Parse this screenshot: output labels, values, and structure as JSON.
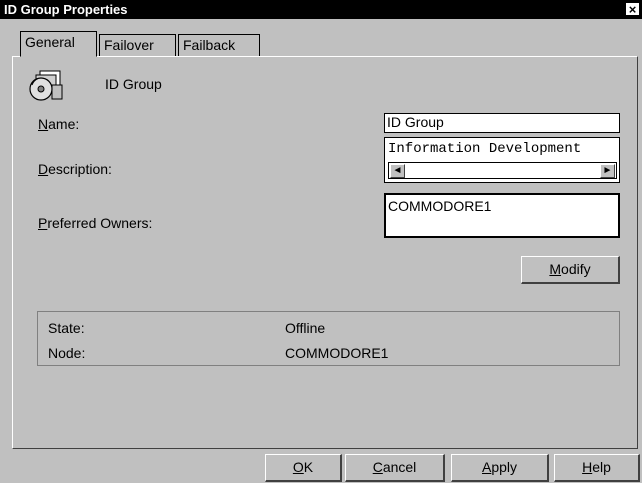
{
  "window": {
    "title": "ID Group Properties",
    "close_glyph": "×"
  },
  "tabs": [
    {
      "label": "General"
    },
    {
      "label": "Failover"
    },
    {
      "label": "Failback"
    }
  ],
  "header": {
    "icon": "group-icon",
    "name": "ID Group"
  },
  "form": {
    "name_label_accel": "N",
    "name_label_rest": "ame:",
    "name_value": "ID Group",
    "description_label_accel": "D",
    "description_label_rest": "escription:",
    "description_value": "Information Development",
    "preferred_label_accel": "P",
    "preferred_label_rest": "referred Owners:",
    "preferred_value": "COMMODORE1",
    "modify_accel": "M",
    "modify_rest": "odify"
  },
  "status": {
    "state_label": "State:",
    "state_value": "Offline",
    "node_label": "Node:",
    "node_value": "COMMODORE1"
  },
  "buttons": {
    "ok_accel": "O",
    "ok_rest": "K",
    "cancel_accel": "C",
    "cancel_rest": "ancel",
    "apply_accel": "A",
    "apply_rest": "pply",
    "help_accel": "H",
    "help_rest": "elp"
  },
  "icons": {
    "scroll_left": "◄",
    "scroll_right": "►"
  }
}
